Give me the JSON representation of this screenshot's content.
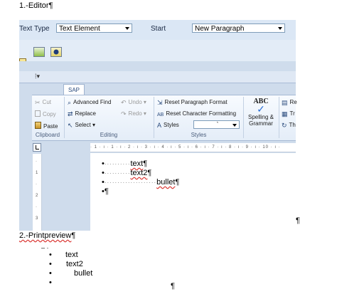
{
  "section1": {
    "title": "1.-Editor",
    "pilcrow": "¶"
  },
  "editor_toolbar": {
    "text_type_label": "Text Type",
    "text_type_value": "Text Element",
    "start_label": "Start",
    "start_value": "New Paragraph"
  },
  "ribbon": {
    "tab": "SAP",
    "clipboard": {
      "cut": "Cut",
      "copy": "Copy",
      "paste": "Paste",
      "label": "Clipboard"
    },
    "editing": {
      "advanced_find": "Advanced Find",
      "replace": "Replace",
      "select": "Select",
      "undo": "Undo",
      "redo": "Redo",
      "label": "Editing"
    },
    "styles": {
      "reset_paragraph": "Reset Paragraph Format",
      "reset_character": "Reset Character Formatting",
      "styles": "Styles",
      "style_value": "`",
      "label": "Styles"
    },
    "proofing": {
      "abc": "ABC",
      "spelling_line1": "Spelling &",
      "spelling_line2": "Grammar"
    },
    "right_cut": {
      "re": "Re",
      "tr": "Tr",
      "th": "Th"
    }
  },
  "ruler_text": "· 1 · ı · 1 · ı · 2 · ı · 3 · ı · 4 · ı · 5 · ı · 6 · ı · 7 · ı · 8 · ı · 9 · ı · 10 · ı ·",
  "vruler_ticks": [
    "·",
    "1",
    "·",
    "2",
    "·",
    "3"
  ],
  "editor_lines": [
    {
      "bullet": "•",
      "dots": "··········",
      "text": "text",
      "pilcrow": "¶"
    },
    {
      "bullet": "•",
      "dots": "··········",
      "text": "text2",
      "pilcrow": "¶"
    },
    {
      "bullet": "•",
      "dots": "····················",
      "text": "bullet",
      "pilcrow": "¶"
    },
    {
      "bullet": "•",
      "dots": "",
      "text": "",
      "pilcrow": "¶"
    }
  ],
  "page_end_pilcrow": "¶",
  "section2": {
    "title": "2.-Printpreview",
    "pilcrow": "¶"
  },
  "preview": {
    "top_mark": "– ·",
    "items": [
      {
        "bullet": "•",
        "text": "text"
      },
      {
        "bullet": "•",
        "text": "text2"
      },
      {
        "bullet": "•",
        "text": "bullet"
      },
      {
        "bullet": "•",
        "text": ""
      }
    ],
    "end_pilcrow": "¶"
  },
  "colors": {
    "band": "#dbe7f5",
    "ribbon": "#e4edf8",
    "accent": "#2a4b7d",
    "misspell": "#d9302c"
  }
}
